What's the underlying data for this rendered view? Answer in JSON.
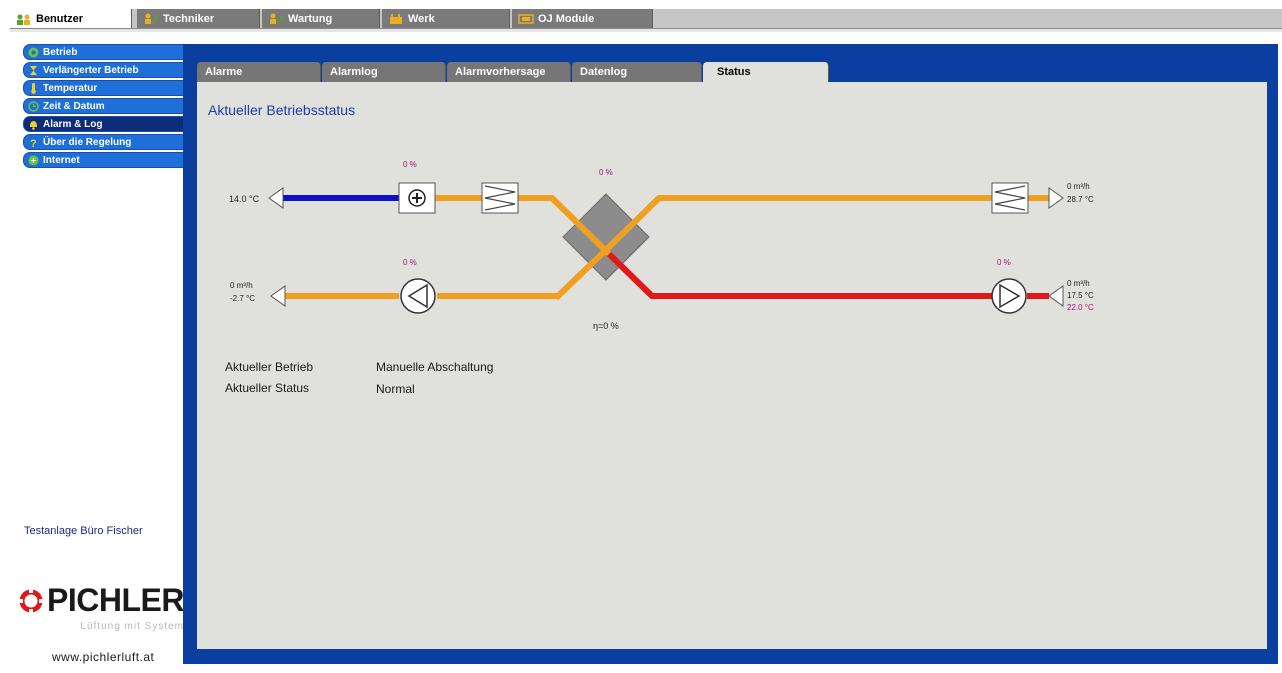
{
  "top_tabs": [
    {
      "label": "Benutzer",
      "active": true,
      "icon": "users-icon"
    },
    {
      "label": "Techniker",
      "active": false,
      "icon": "technician-icon"
    },
    {
      "label": "Wartung",
      "active": false,
      "icon": "maintenance-icon"
    },
    {
      "label": "Werk",
      "active": false,
      "icon": "factory-icon"
    },
    {
      "label": "OJ Module",
      "active": false,
      "icon": "module-icon"
    }
  ],
  "sidebar": {
    "items": [
      {
        "label": "Betrieb",
        "active": false,
        "icon": "operation-icon"
      },
      {
        "label": "Verlängerter Betrieb",
        "active": false,
        "icon": "hourglass-icon"
      },
      {
        "label": "Temperatur",
        "active": false,
        "icon": "thermometer-icon"
      },
      {
        "label": "Zeit & Datum",
        "active": false,
        "icon": "clock-icon"
      },
      {
        "label": "Alarm & Log",
        "active": true,
        "icon": "bell-icon"
      },
      {
        "label": "Über die Regelung",
        "active": false,
        "icon": "question-icon"
      },
      {
        "label": "Internet",
        "active": false,
        "icon": "globe-icon"
      }
    ],
    "site_name": "Testanlage Büro Fischer",
    "logo_text": "PICHLER",
    "logo_tagline": "Lüftung mit System",
    "website": "www.pichlerluft.at"
  },
  "sub_tabs": [
    {
      "label": "Alarme",
      "active": false
    },
    {
      "label": "Alarmlog",
      "active": false
    },
    {
      "label": "Alarmvorhersage",
      "active": false
    },
    {
      "label": "Datenlog",
      "active": false
    },
    {
      "label": "Status",
      "active": true
    }
  ],
  "main": {
    "title": "Aktueller Betriebsstatus",
    "diagram": {
      "outdoor_temp": "14.0 °C",
      "heater_pct": "0 %",
      "recovery_pct": "0 %",
      "supply_flow": "0 m³/h",
      "supply_temp": "28.7 °C",
      "exhaust_fan_pct": "0 %",
      "exhaust_flow": "0 m³/h",
      "exhaust_temp": "-2.7 °C",
      "supply_fan_pct": "0 %",
      "extract_flow": "0 m³/h",
      "extract_temp": "17.5 °C",
      "extract_setpoint": "22.0 °C",
      "efficiency": "η=0 %"
    },
    "info": [
      {
        "label": "Aktueller Betrieb",
        "value": "Manuelle Abschaltung"
      },
      {
        "label": "Aktueller Status",
        "value": "Normal"
      }
    ]
  },
  "colors": {
    "supply_cold": "#1010c8",
    "duct_orange": "#f0a020",
    "duct_red": "#e01818",
    "percent": "#b0107a",
    "nav_blue": "#1e6fd9",
    "frame_blue": "#0a3fa0"
  }
}
